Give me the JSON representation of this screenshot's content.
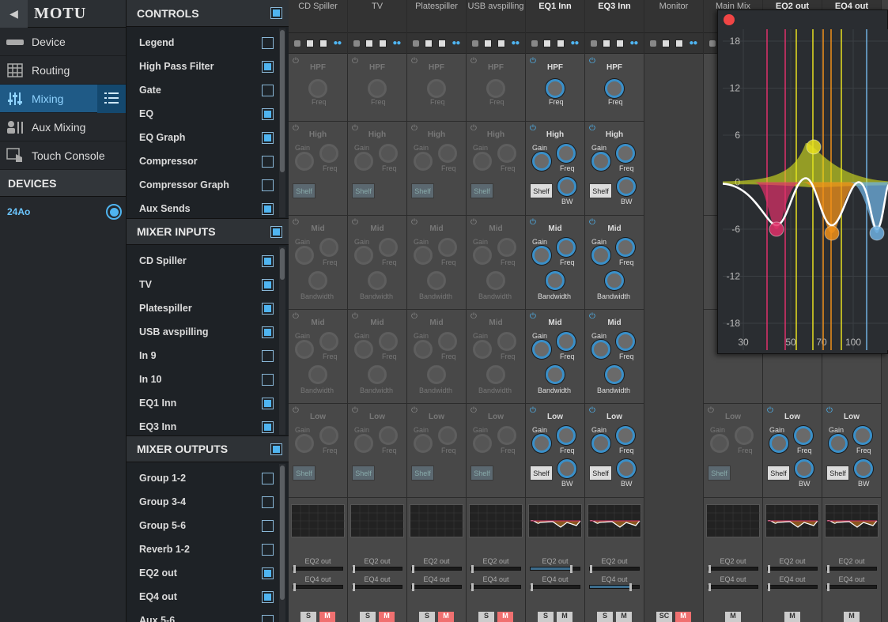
{
  "app": {
    "brand": "MOTU"
  },
  "nav": {
    "items": [
      {
        "label": "Device",
        "icon": "device-icon"
      },
      {
        "label": "Routing",
        "icon": "routing-grid-icon"
      },
      {
        "label": "Mixing",
        "icon": "mixer-sliders-icon",
        "active": true
      },
      {
        "label": "Aux Mixing",
        "icon": "aux-mixing-icon"
      },
      {
        "label": "Touch Console",
        "icon": "touch-console-icon"
      }
    ],
    "devices_header": "DEVICES",
    "device": "24Ao"
  },
  "controls": {
    "header": "CONTROLS",
    "items": [
      {
        "label": "Legend",
        "checked": false
      },
      {
        "label": "High Pass Filter",
        "checked": true
      },
      {
        "label": "Gate",
        "checked": false
      },
      {
        "label": "EQ",
        "checked": true
      },
      {
        "label": "EQ Graph",
        "checked": true
      },
      {
        "label": "Compressor",
        "checked": false
      },
      {
        "label": "Compressor Graph",
        "checked": false
      },
      {
        "label": "Aux Sends",
        "checked": true
      }
    ]
  },
  "mixer_inputs": {
    "header": "MIXER INPUTS",
    "items": [
      {
        "label": "CD Spiller",
        "checked": true
      },
      {
        "label": "TV",
        "checked": true
      },
      {
        "label": "Platespiller",
        "checked": true
      },
      {
        "label": "USB avspilling",
        "checked": true
      },
      {
        "label": "In 9",
        "checked": false
      },
      {
        "label": "In 10",
        "checked": false
      },
      {
        "label": "EQ1 Inn",
        "checked": true
      },
      {
        "label": "EQ3 Inn",
        "checked": true
      }
    ]
  },
  "mixer_outputs": {
    "header": "MIXER OUTPUTS",
    "items": [
      {
        "label": "Group 1-2",
        "checked": false
      },
      {
        "label": "Group 3-4",
        "checked": false
      },
      {
        "label": "Group 5-6",
        "checked": false
      },
      {
        "label": "Reverb 1-2",
        "checked": false
      },
      {
        "label": "EQ2 out",
        "checked": true
      },
      {
        "label": "EQ4 out",
        "checked": true
      },
      {
        "label": "Aux 5-6",
        "checked": false
      }
    ]
  },
  "labels": {
    "hpf": "HPF",
    "freq": "Freq",
    "high": "High",
    "mid": "Mid",
    "low": "Low",
    "gain": "Gain",
    "shelf": "Shelf",
    "bw": "BW",
    "bandwidth": "Bandwidth",
    "send1": "EQ2 out",
    "send2": "EQ4 out",
    "solo": "S",
    "mute": "M",
    "solo_clear": "SC"
  },
  "strips": [
    {
      "name": "CD Spiller",
      "active": false
    },
    {
      "name": "TV",
      "active": false
    },
    {
      "name": "Platespiller",
      "active": false
    },
    {
      "name": "USB avspilling",
      "active": false
    },
    {
      "name": "EQ1 Inn",
      "active": true
    },
    {
      "name": "EQ3 Inn",
      "active": true
    },
    {
      "name": "Monitor",
      "active": false,
      "monitor": true
    },
    {
      "name": "Main Mix",
      "active": false,
      "out": true
    },
    {
      "name": "EQ2 out",
      "active": true,
      "out": true
    },
    {
      "name": "EQ4 out",
      "active": true,
      "out": true
    }
  ],
  "eq_graph": {
    "y_ticks": [
      "18",
      "12",
      "6",
      "0",
      "-6",
      "-12",
      "-18"
    ],
    "x_ticks": [
      "30",
      "50",
      "70",
      "100"
    ],
    "colors": {
      "pink": "#e0306a",
      "yellow": "#e8e020",
      "orange": "#f0901a",
      "blue": "#6fb0e0",
      "curve": "#ffffff"
    }
  }
}
